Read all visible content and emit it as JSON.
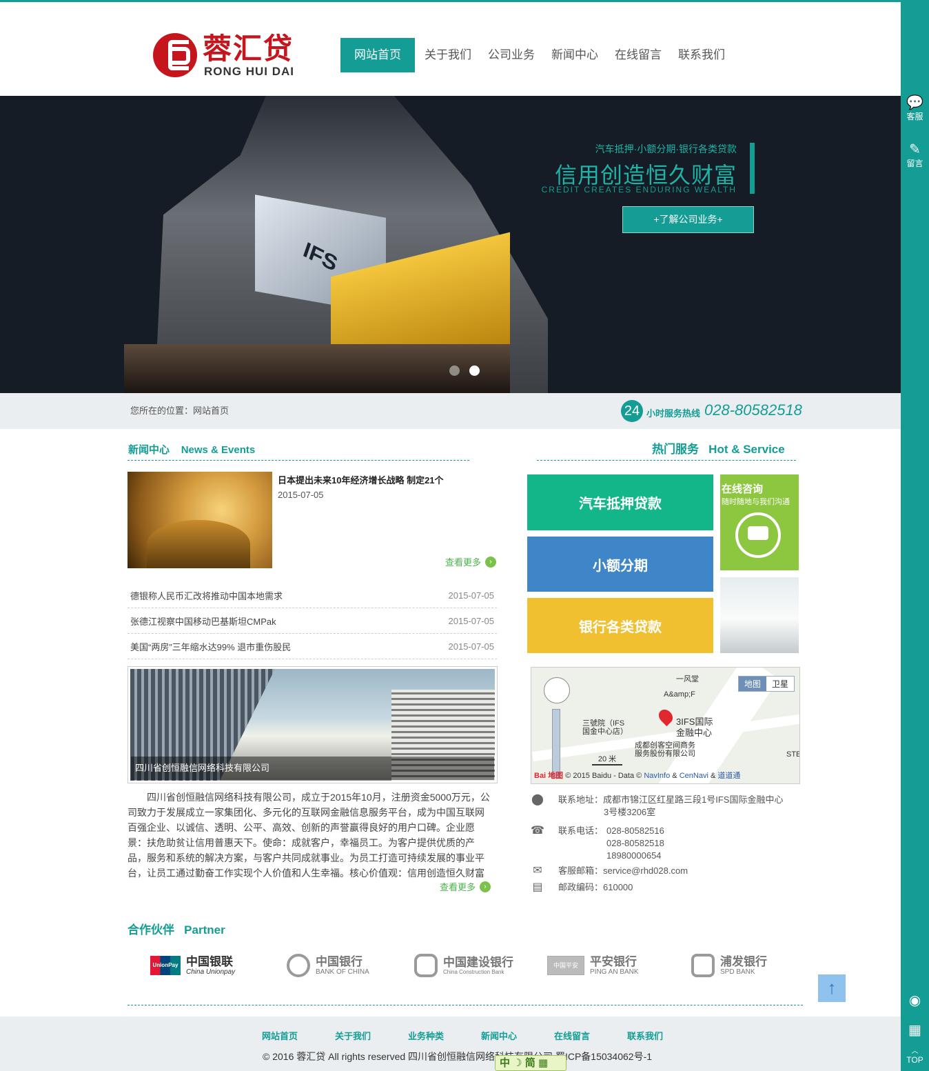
{
  "header": {
    "logo_cn": "蓉汇贷",
    "logo_en": "RONG HUI DAI",
    "nav": [
      {
        "label": "网站首页",
        "active": true
      },
      {
        "label": "关于我们",
        "active": false
      },
      {
        "label": "公司业务",
        "active": false
      },
      {
        "label": "新闻中心",
        "active": false
      },
      {
        "label": "在线留言",
        "active": false
      },
      {
        "label": "联系我们",
        "active": false
      }
    ]
  },
  "banner": {
    "sign_text": "IFS",
    "slogan_sub": "汽车抵押·小额分期·银行各类贷款",
    "slogan_main": "信用创造恒久财富",
    "slogan_en": "CREDIT CREATES ENDURING WEALTH",
    "button": "+了解公司业务+",
    "slide_count": 2,
    "active_slide": 2
  },
  "crumb": {
    "text": "您所在的位置：网站首页",
    "hotline_badge": "24",
    "hotline_label": "小时服务热线",
    "hotline_number": "028-80582518"
  },
  "news": {
    "heading_cn": "新闻中心",
    "heading_en": "News & Events",
    "featured_title": "日本提出未来10年经济增长战略 制定21个",
    "featured_date": "2015-07-05",
    "more": "查看更多",
    "items": [
      {
        "title": "德银称人民币汇改将推动中国本地需求",
        "date": "2015-07-05"
      },
      {
        "title": "张德江视察中国移动巴基斯坦CMPak",
        "date": "2015-07-05"
      },
      {
        "title": "美国“两房”三年缩水达99% 退市重伤股民",
        "date": "2015-07-05"
      }
    ]
  },
  "company": {
    "caption": "四川省创恒融信网络科技有限公司",
    "text": "四川省创恒融信网络科技有限公司，成立于2015年10月，注册资金5000万元，公司致力于发展成立一家集团化、多元化的互联网金融信息服务平台，成为中国互联网百强企业、以诚信、透明、公平、高效、创新的声誉赢得良好的用户口碑。企业愿景：扶危助贫让信用普惠天下。使命：成就客户，幸福员工。为客户提供优质的产品，服务和系统的解决方案，与客户共同成就事业。为员工打造可持续发展的事业平台，让员工通过勤奋工作实现个人价值和人生幸福。核心价值观：信用创造恒久财富",
    "more": "查看更多"
  },
  "service": {
    "heading_cn": "热门服务",
    "heading_en": "Hot & Service",
    "tiles": [
      {
        "label": "汽车抵押贷款",
        "color": "#13b688"
      },
      {
        "label": "小额分期",
        "color": "#3f86c8"
      },
      {
        "label": "银行各类贷款",
        "color": "#f0c030"
      }
    ],
    "consult_title": "在线咨询",
    "consult_sub": "随时随地与我们沟通"
  },
  "map": {
    "tab_map": "地图",
    "tab_sat": "卫星",
    "labels": [
      "一风堂",
      "A&amp;F",
      "三號院（IFS",
      "国金中心店）",
      "3IFS国际",
      "金融中心",
      "成都创客空间商务",
      "服务股份有限公司",
      "STE"
    ],
    "scale": "20 米",
    "copy_prefix": "© 2015 Baidu - Data ©",
    "copy_links": [
      "NavInfo",
      "CenNavi",
      "道道通"
    ],
    "copy_amp": "&",
    "baidu_logo": "Bai",
    "baidu_map": "地图"
  },
  "contact": {
    "address_label": "联系地址：成都市锦江区红星路三段1号IFS国际金融中心",
    "address_line2": "3号楼3206室",
    "phone_label": "联系电话：",
    "phones": [
      "028-80582516",
      "028-80582518",
      "18980000654"
    ],
    "email": "客服邮箱：service@rhd028.com",
    "postcode": "邮政编码：610000"
  },
  "partners": {
    "heading_cn": "合作伙伴",
    "heading_en": "Partner",
    "items": [
      {
        "cn": "中国银联",
        "en": "China Unionpay",
        "badge": "UnionPay 银联"
      },
      {
        "cn": "中国银行",
        "en": "BANK OF CHINA"
      },
      {
        "cn": "中国建设银行",
        "en": "China Construction Bank"
      },
      {
        "cn": "平安银行",
        "en": "PING AN BANK",
        "badge": "中国平安"
      },
      {
        "cn": "浦发银行",
        "en": "SPD BANK"
      }
    ]
  },
  "footer": {
    "nav": [
      "网站首页",
      "关于我们",
      "业务种类",
      "新闻中心",
      "在线留言",
      "联系我们"
    ],
    "copyright": "© 2016 蓉汇贷 All rights reserved 四川省创恒融信网络科技有限公司 蜀ICP备15034062号-1",
    "ime": "中 ☽ 简 ▦"
  },
  "sidebar": {
    "service": "客服",
    "message": "留言",
    "top": "TOP"
  },
  "colors": {
    "brand": "#139d94",
    "logo_red": "#c4161c"
  }
}
